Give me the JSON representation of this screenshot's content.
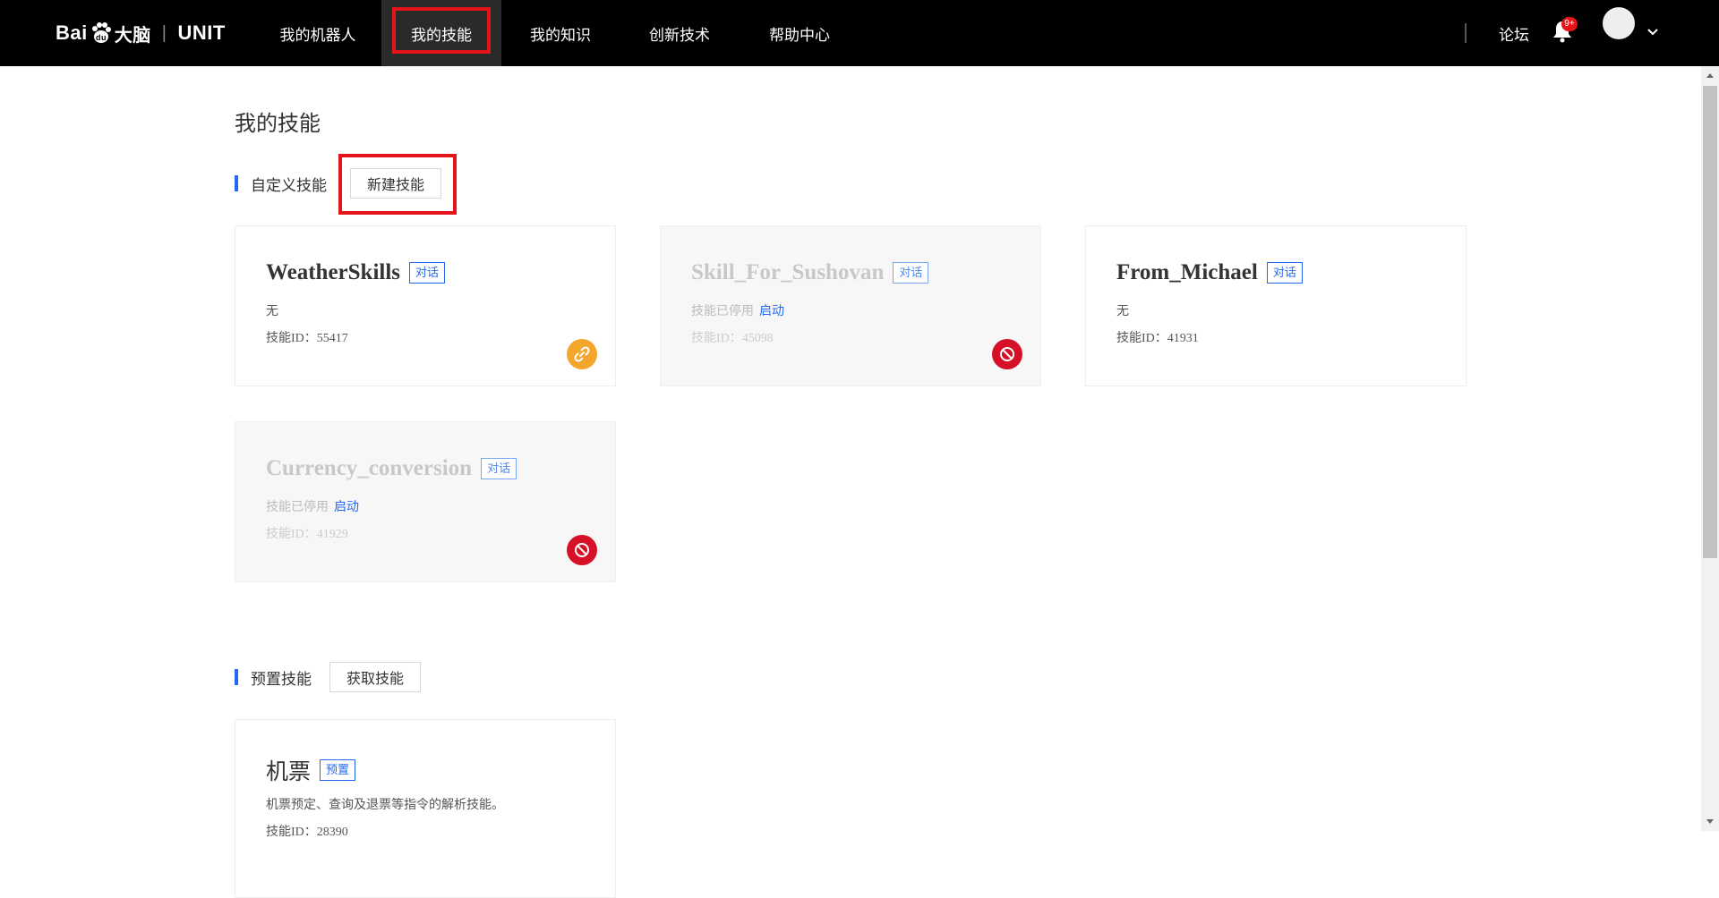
{
  "header": {
    "logo_text": "Bai",
    "logo_du": "du",
    "logo_brain": "大脑",
    "logo_unit": "UNIT",
    "nav": [
      {
        "label": "我的机器人"
      },
      {
        "label": "我的技能"
      },
      {
        "label": "我的知识"
      },
      {
        "label": "创新技术"
      },
      {
        "label": "帮助中心"
      }
    ],
    "forum_label": "论坛",
    "notification_badge": "9+"
  },
  "page": {
    "title": "我的技能"
  },
  "custom_section": {
    "label": "自定义技能",
    "button_label": "新建技能",
    "cards": [
      {
        "name": "WeatherSkills",
        "tag": "对话",
        "desc": "无",
        "id_label": "技能ID：55417",
        "status": "active",
        "icon": "link-icon"
      },
      {
        "name": "Skill_For_Sushovan",
        "tag": "对话",
        "desc": "技能已停用",
        "enable": "启动",
        "id_label": "技能ID：45098",
        "status": "disabled",
        "icon": "ban-icon"
      },
      {
        "name": "From_Michael",
        "tag": "对话",
        "desc": "无",
        "id_label": "技能ID：41931",
        "status": "active"
      },
      {
        "name": "Currency_conversion",
        "tag": "对话",
        "desc": "技能已停用",
        "enable": "启动",
        "id_label": "技能ID：41929",
        "status": "disabled",
        "icon": "ban-icon"
      }
    ]
  },
  "preset_section": {
    "label": "预置技能",
    "button_label": "获取技能",
    "cards": [
      {
        "name": "机票",
        "tag": "预置",
        "desc": "机票预定、查询及退票等指令的解析技能。",
        "id_label": "技能ID：28390"
      }
    ]
  },
  "colors": {
    "accent": "#2468f2",
    "highlight": "#e5141a",
    "link_icon": "#f4a52b",
    "ban_icon": "#d51027"
  }
}
